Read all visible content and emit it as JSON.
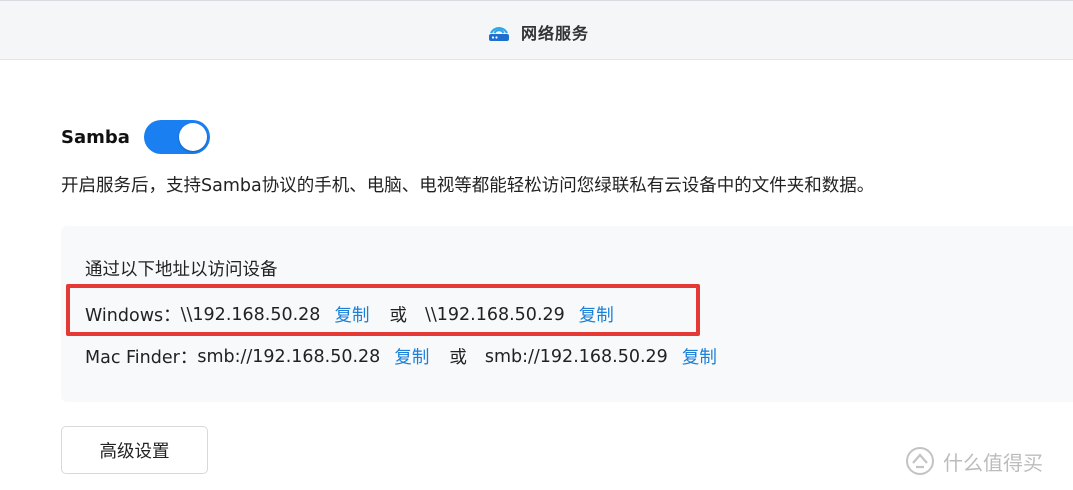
{
  "header": {
    "title": "网络服务",
    "icon": "network-service-icon"
  },
  "samba": {
    "label": "Samba",
    "enabled": true,
    "toggle_color": "#1a7ff0",
    "description": "开启服务后，支持Samba协议的手机、电脑、电视等都能轻松访问您绿联私有云设备中的文件夹和数据。"
  },
  "access": {
    "title": "通过以下地址以访问设备",
    "or_text": "或",
    "copy_label": "复制",
    "windows": {
      "label": "Windows：",
      "address_1": "\\\\192.168.50.28",
      "address_2": "\\\\192.168.50.29"
    },
    "mac": {
      "label": "Mac Finder：",
      "address_1": "smb://192.168.50.28",
      "address_2": "smb://192.168.50.29"
    },
    "link_color": "#1a7fd6",
    "highlight_color": "#e53935"
  },
  "advanced_button": {
    "label": "高级设置"
  },
  "watermark": {
    "text": "什么值得买"
  }
}
